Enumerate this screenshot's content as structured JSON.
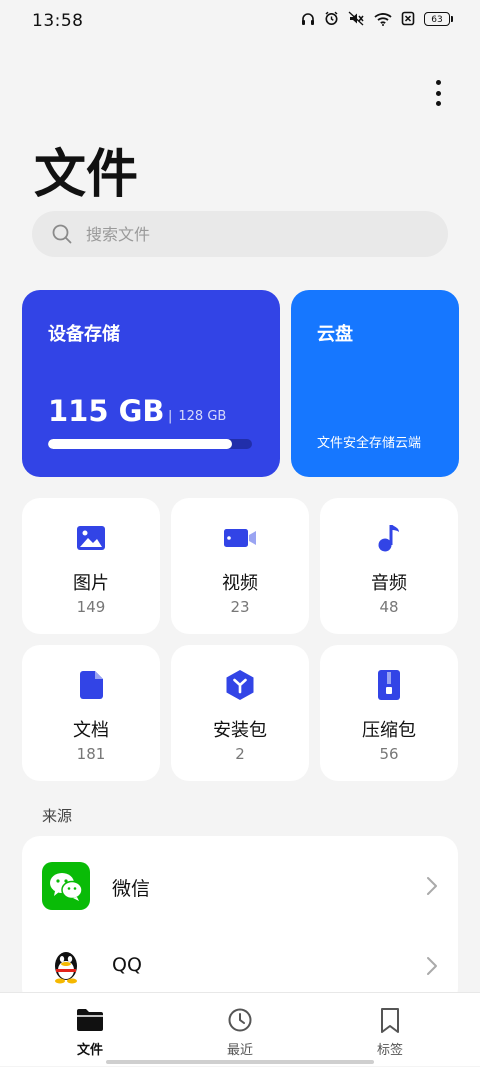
{
  "status_bar": {
    "time": "13:58",
    "battery": "63"
  },
  "header": {
    "title": "文件"
  },
  "search": {
    "placeholder": "搜索文件"
  },
  "storage": {
    "device": {
      "label": "设备存储",
      "used": "115 GB",
      "total": "128 GB",
      "used_fraction": 0.9
    },
    "cloud": {
      "label": "云盘",
      "description": "文件安全存储云端"
    }
  },
  "categories": [
    {
      "name": "图片",
      "count": "149",
      "icon": "image-icon"
    },
    {
      "name": "视频",
      "count": "23",
      "icon": "video-icon"
    },
    {
      "name": "音频",
      "count": "48",
      "icon": "music-note-icon"
    },
    {
      "name": "文档",
      "count": "181",
      "icon": "document-icon"
    },
    {
      "name": "安装包",
      "count": "2",
      "icon": "package-icon"
    },
    {
      "name": "压缩包",
      "count": "56",
      "icon": "archive-icon"
    }
  ],
  "sources": {
    "title": "来源",
    "items": [
      {
        "name": "微信",
        "icon": "wechat-icon"
      },
      {
        "name": "QQ",
        "icon": "qq-icon"
      }
    ]
  },
  "bottom_nav": [
    {
      "label": "文件",
      "icon": "folder-icon",
      "active": true
    },
    {
      "label": "最近",
      "icon": "clock-icon",
      "active": false
    },
    {
      "label": "标签",
      "icon": "bookmark-icon",
      "active": false
    }
  ],
  "colors": {
    "accent": "#3244e6",
    "cloud": "#1677ff",
    "wechat": "#09bb07",
    "background": "#f4f4f4"
  }
}
